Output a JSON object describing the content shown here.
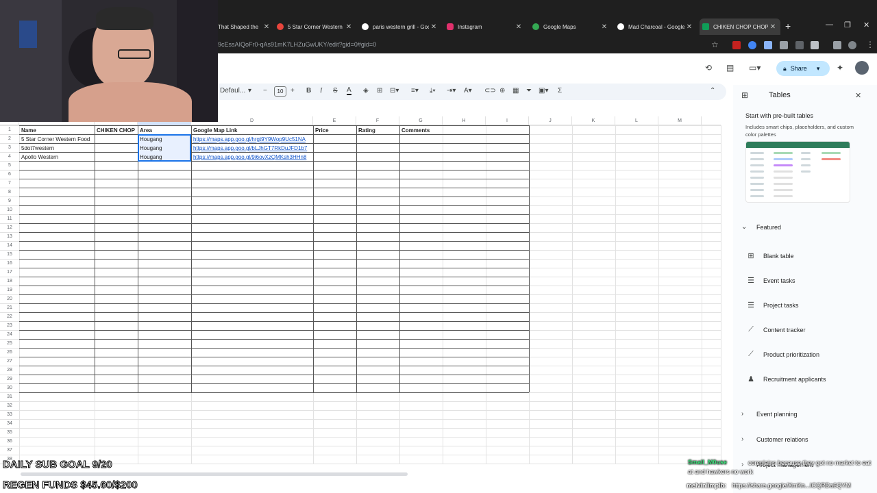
{
  "browser": {
    "tabs": [
      {
        "label": "That Shaped the",
        "icon_color": "#8ab4f8"
      },
      {
        "label": "5 Star Corner Western F",
        "icon_color": "#e8453c"
      },
      {
        "label": "paris western grill - Goo",
        "icon_color": "#ffffff"
      },
      {
        "label": "Instagram",
        "icon_color": "#e1306c"
      },
      {
        "label": "Google Maps",
        "icon_color": "#34a853"
      },
      {
        "label": "Mad Charcoal - Google",
        "icon_color": "#ffffff"
      },
      {
        "label": "CHIKEN CHOP CHOP C",
        "icon_color": "#0f9d58",
        "active": true
      }
    ],
    "url": "9cEssAIQoFr0-qAs91mK7LHZuGwUKY/edit?gid=0#gid=0"
  },
  "header": {
    "share_label": "Share"
  },
  "toolbar": {
    "font": "Defaul...",
    "font_size": "10"
  },
  "sheet": {
    "columns": [
      "D",
      "E",
      "F",
      "G",
      "H",
      "I",
      "J",
      "K",
      "L",
      "M"
    ],
    "headers": {
      "name": "Name",
      "chiken": "CHIKEN CHOP",
      "area": "Area",
      "link": "Google Map Link",
      "price": "Price",
      "rating": "Rating",
      "comments": "Comments"
    },
    "rows": [
      {
        "name": "5 Star Corner Western Food",
        "area": "Hougang",
        "link": "https://maps.app.goo.gl/hrgt9Y9Wop9Uc51NA"
      },
      {
        "name": "5dot7western",
        "area": "Hougang",
        "link": "https://maps.app.goo.gl/bLJhGT7RkDuJFD1b7"
      },
      {
        "name": "Apollo Western",
        "area": "Hougang",
        "link": "https://maps.app.goo.gl/9i6ovXzQMKsh3HHn8"
      }
    ],
    "row_numbers": [
      "1",
      "2",
      "3",
      "4",
      "5",
      "6",
      "7",
      "8",
      "9",
      "10",
      "11",
      "12",
      "13",
      "14",
      "15",
      "16",
      "17",
      "18",
      "19",
      "20",
      "21",
      "22",
      "23",
      "24",
      "25",
      "26",
      "27",
      "28",
      "29",
      "30",
      "31",
      "32",
      "33",
      "34",
      "35",
      "36",
      "37",
      "38"
    ]
  },
  "panel": {
    "title": "Tables",
    "subtitle": "Start with pre-built tables",
    "description": "Includes smart chips, placeholders, and custom color palettes",
    "featured_label": "Featured",
    "items": [
      {
        "label": "Blank table",
        "icon": "table-icon"
      },
      {
        "label": "Event tasks",
        "icon": "checklist-icon"
      },
      {
        "label": "Project tasks",
        "icon": "checklist-icon"
      },
      {
        "label": "Content tracker",
        "icon": "trend-icon"
      },
      {
        "label": "Product prioritization",
        "icon": "trend-icon"
      },
      {
        "label": "Recruitment applicants",
        "icon": "person-icon"
      }
    ],
    "sections": [
      {
        "label": "Event planning"
      },
      {
        "label": "Customer relations"
      },
      {
        "label": "Project management"
      }
    ]
  },
  "stream": {
    "sub_goal": "DAILY SUB GOAL 9/20",
    "regen_funds": "REGEN FUNDS $45.60/$200",
    "chat": [
      {
        "user": "Small_M0use",
        "message": "complains because they got no market to eat at and hawkers no work",
        "color": "#3ee07a"
      },
      {
        "user": "melvinlimplb:",
        "message": "https://share.google/XmKn...ICQRDa6QYM",
        "color": "#ffffff"
      }
    ]
  }
}
